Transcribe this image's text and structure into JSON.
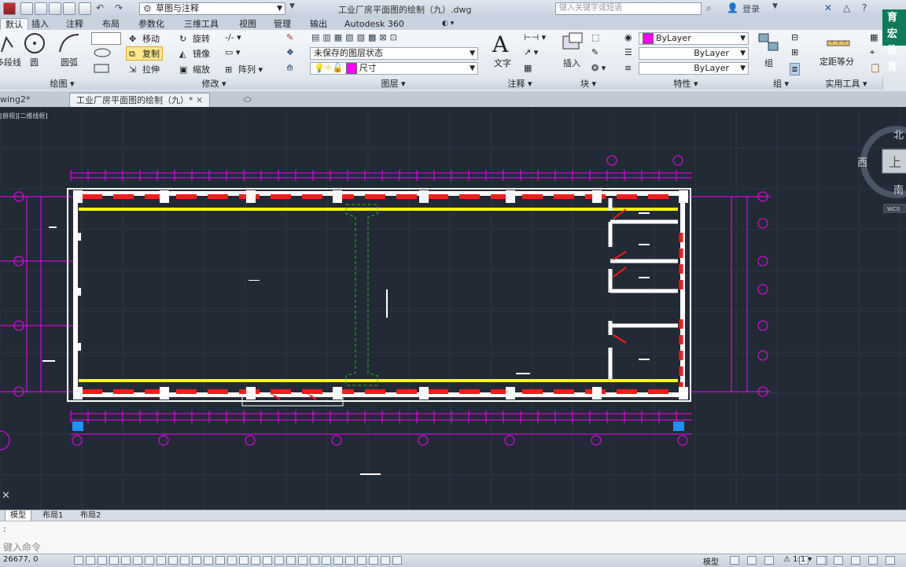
{
  "titlebar": {
    "workspace": "草图与注释",
    "document_title": "工业厂房平面图的绘制（九）.dwg",
    "search_placeholder": "键入关键字或短语",
    "login_label": "登录"
  },
  "ribbon_tabs": [
    "默认",
    "插入",
    "注释",
    "布局",
    "参数化",
    "三维工具",
    "视图",
    "管理",
    "输出",
    "Autodesk 360"
  ],
  "ribbon": {
    "draw": {
      "items": [
        "多段线",
        "圆",
        "圆弧"
      ],
      "panel_label": "绘图 ▾"
    },
    "modify": {
      "move": "移动",
      "rotate": "旋转",
      "copy": "复制",
      "mirror": "镜像",
      "stretch": "拉伸",
      "scale": "缩放",
      "array": "阵列",
      "panel_label": "修改 ▾"
    },
    "layers": {
      "layer_state": "未保存的图层状态",
      "current_layer": "尺寸",
      "panel_label": "图层 ▾"
    },
    "annotation": {
      "text": "文字",
      "panel_label": "注释 ▾"
    },
    "block": {
      "insert": "插入",
      "panel_label": "块 ▾"
    },
    "properties": {
      "color": "ByLayer",
      "linetype": "ByLayer",
      "lineweight": "ByLayer",
      "panel_label": "特性 ▾"
    },
    "groups": {
      "group": "组",
      "panel_label": "组 ▾"
    },
    "utilities": {
      "measure": "定距等分",
      "panel_label": "实用工具 ▾"
    }
  },
  "doc_tabs": [
    "wing2*",
    "工业厂房平面图的绘制（九）*"
  ],
  "viewport": {
    "label": "[俯视][二维线框]",
    "viewcube": {
      "north": "北",
      "south": "南",
      "west": "西",
      "face": "上",
      "wcs": "WCS"
    }
  },
  "layout_tabs": [
    "模型",
    "布局1",
    "布局2"
  ],
  "command": {
    "placeholder": "键入命令"
  },
  "statusbar": {
    "coords": "26677, 0",
    "model_label": "模型",
    "scale": "1:1"
  },
  "watermark": {
    "line1": "育宏",
    "line2": "教育"
  },
  "colors": {
    "canvas_bg": "#222a35",
    "magenta": "#ff00ff",
    "red": "#ff1a1a",
    "yellow": "#ffff00",
    "white": "#ffffff",
    "green": "#22bb22",
    "blue": "#1e90ff",
    "grid": "#2c3542"
  }
}
